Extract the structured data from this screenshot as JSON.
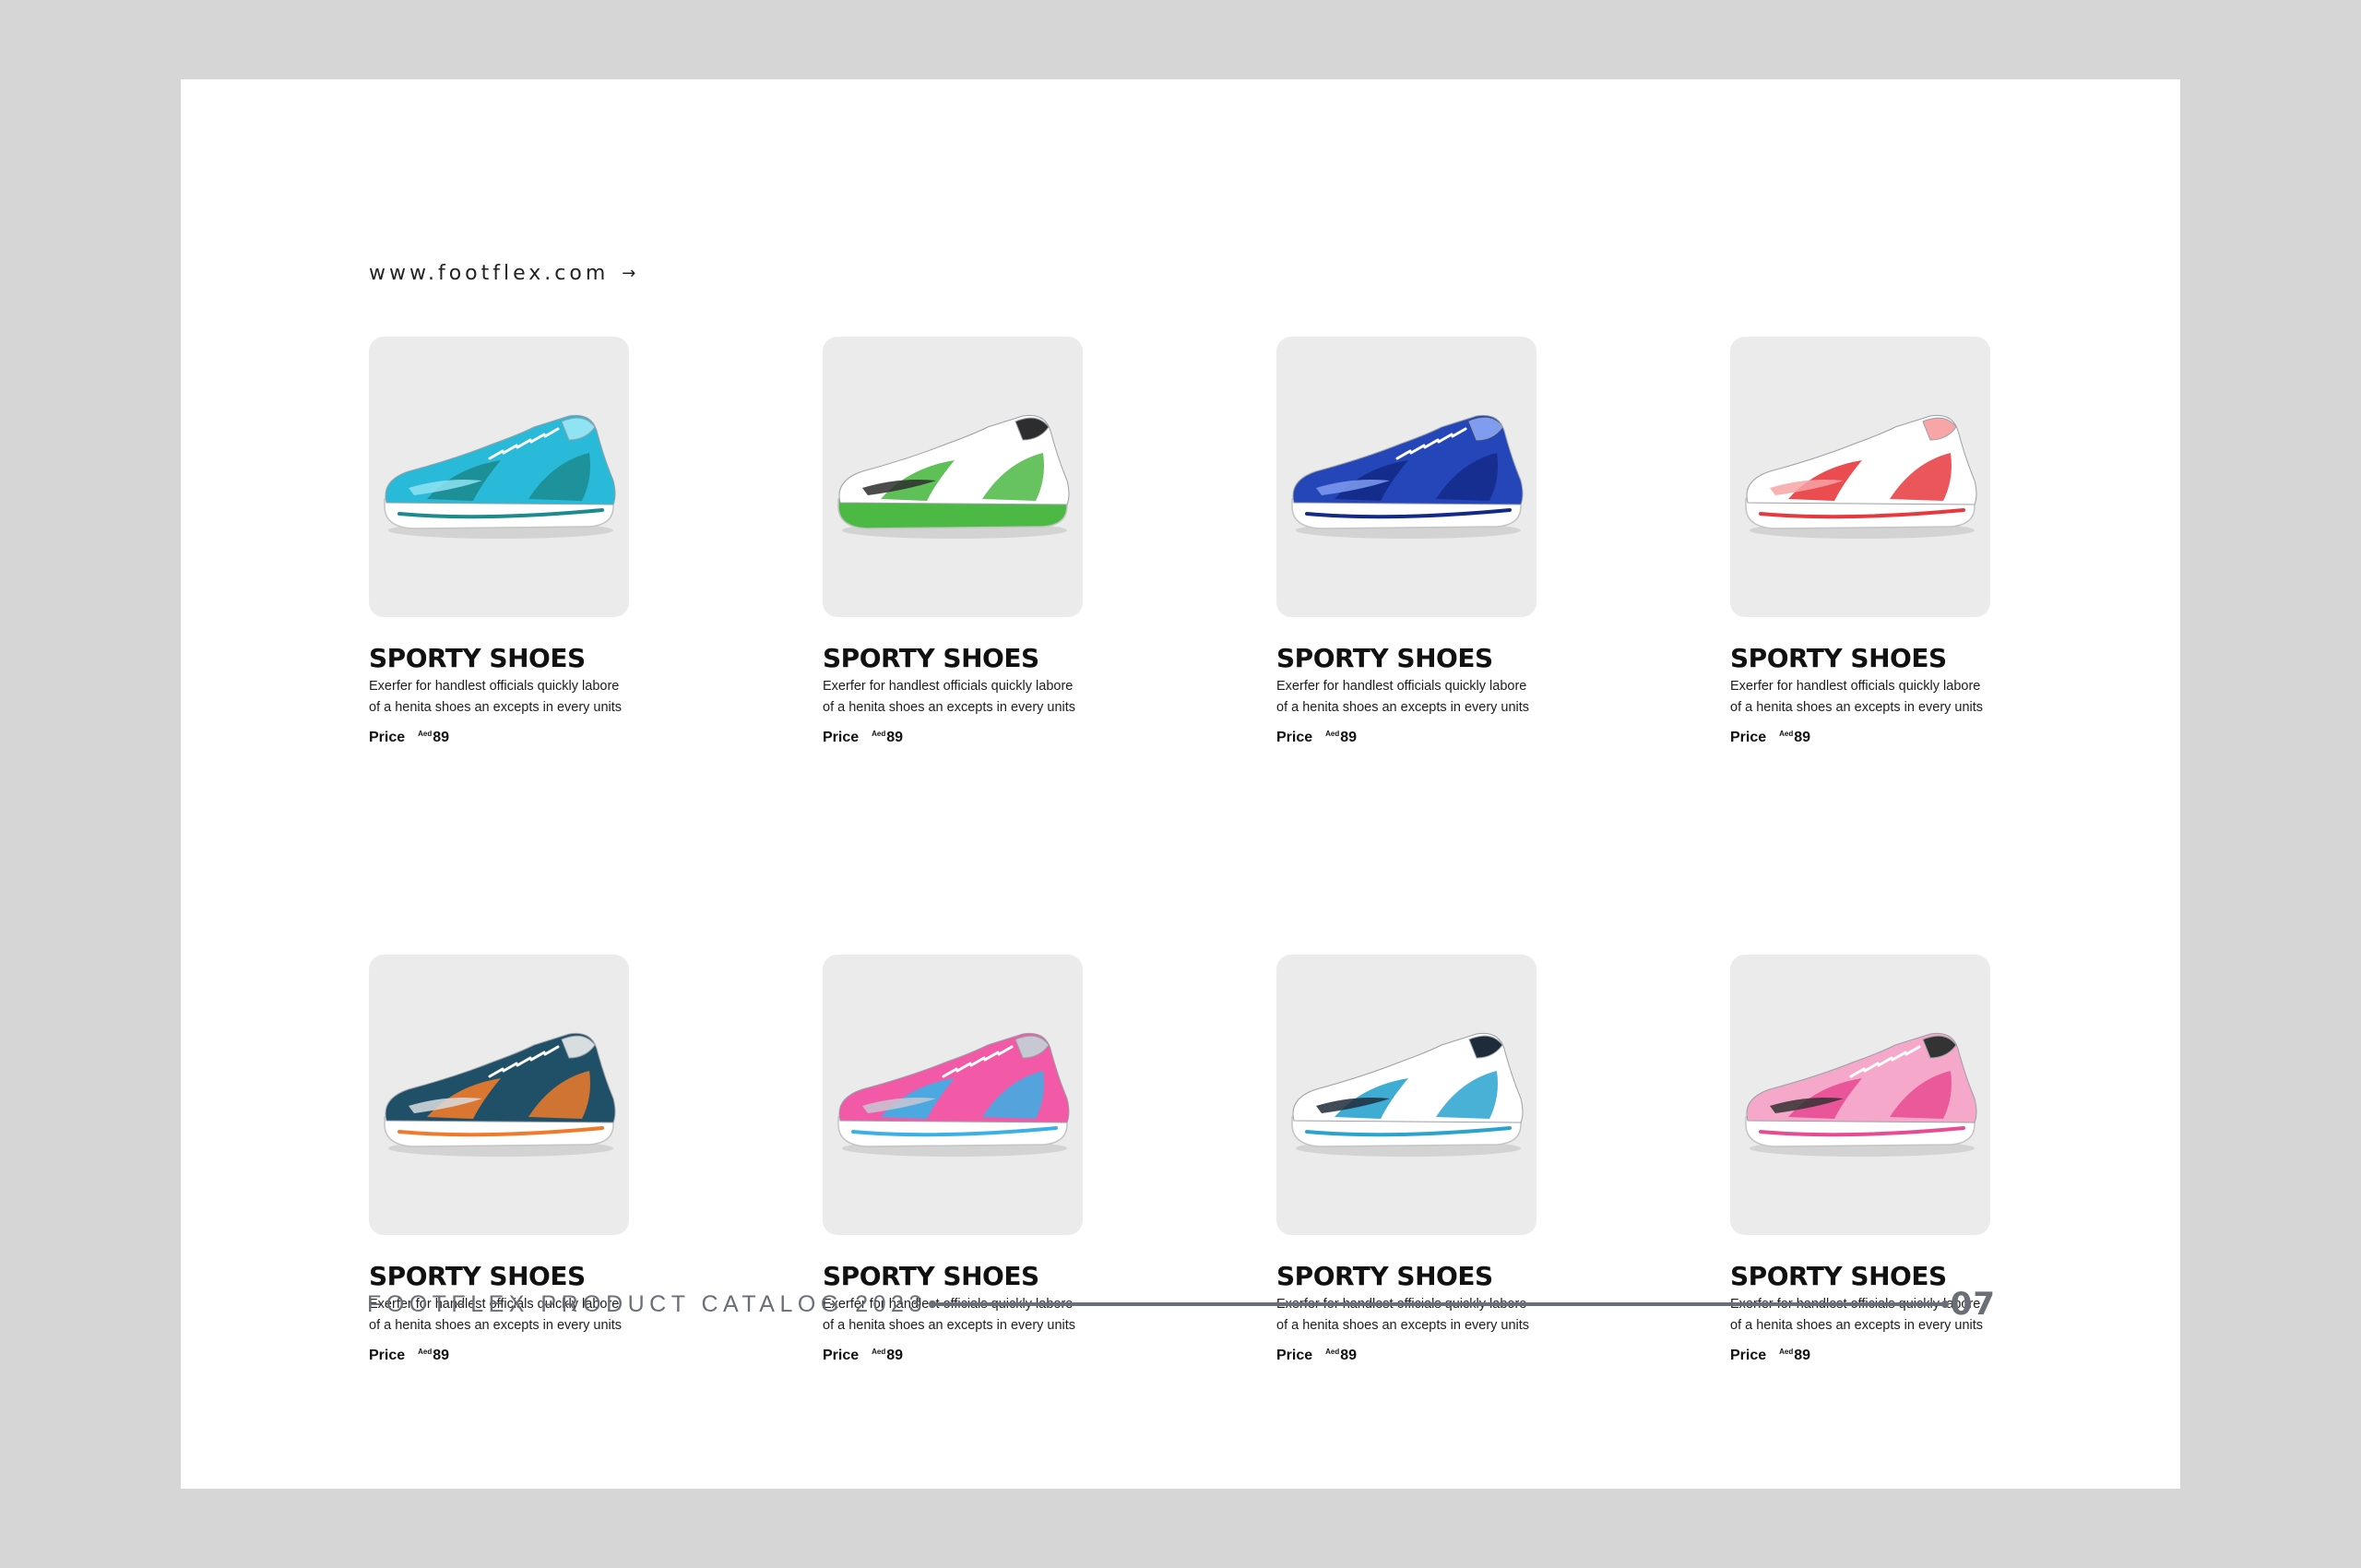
{
  "site_url": "www.footflex.com",
  "products": [
    {
      "title": "SPORTY SHOES",
      "desc_line1": "Exerfer for handlest officials quickly labore",
      "desc_line2": "of a henita shoes an excepts in every units",
      "price_label": "Price",
      "currency": "Aed",
      "price": "89",
      "colors": {
        "main": "#29b9d9",
        "accent": "#1b8b8f",
        "detail": "#8fe3f2",
        "sole": "#ffffff"
      }
    },
    {
      "title": "SPORTY SHOES",
      "desc_line1": "Exerfer for handlest officials quickly labore",
      "desc_line2": "of a henita shoes an excepts in every units",
      "price_label": "Price",
      "currency": "Aed",
      "price": "89",
      "colors": {
        "main": "#ffffff",
        "accent": "#4cb944",
        "detail": "#2d2d2d",
        "sole": "#4cb944"
      }
    },
    {
      "title": "SPORTY SHOES",
      "desc_line1": "Exerfer for handlest officials quickly labore",
      "desc_line2": "of a henita shoes an excepts in every units",
      "price_label": "Price",
      "currency": "Aed",
      "price": "89",
      "colors": {
        "main": "#2446b8",
        "accent": "#132a88",
        "detail": "#7f9cf0",
        "sole": "#ffffff"
      }
    },
    {
      "title": "SPORTY SHOES",
      "desc_line1": "Exerfer for handlest officials quickly labore",
      "desc_line2": "of a henita shoes an excepts in every units",
      "price_label": "Price",
      "currency": "Aed",
      "price": "89",
      "colors": {
        "main": "#ffffff",
        "accent": "#e8383d",
        "detail": "#f7a5a7",
        "sole": "#ffffff"
      }
    },
    {
      "title": "SPORTY SHOES",
      "desc_line1": "Exerfer for handlest officials quickly labore",
      "desc_line2": "of a henita shoes an excepts in every units",
      "price_label": "Price",
      "currency": "Aed",
      "price": "89",
      "colors": {
        "main": "#1f5068",
        "accent": "#f07a2a",
        "detail": "#d8dde0",
        "sole": "#ffffff"
      }
    },
    {
      "title": "SPORTY SHOES",
      "desc_line1": "Exerfer for handlest officials quickly labore",
      "desc_line2": "of a henita shoes an excepts in every units",
      "price_label": "Price",
      "currency": "Aed",
      "price": "89",
      "colors": {
        "main": "#f25aa8",
        "accent": "#3ab0e6",
        "detail": "#c8c8d2",
        "sole": "#ffffff"
      }
    },
    {
      "title": "SPORTY SHOES",
      "desc_line1": "Exerfer for handlest officials quickly labore",
      "desc_line2": "of a henita shoes an excepts in every units",
      "price_label": "Price",
      "currency": "Aed",
      "price": "89",
      "colors": {
        "main": "#ffffff",
        "accent": "#2aa3cf",
        "detail": "#1e2b3a",
        "sole": "#ffffff"
      }
    },
    {
      "title": "SPORTY SHOES",
      "desc_line1": "Exerfer for handlest officials quickly labore",
      "desc_line2": "of a henita shoes an excepts in every units",
      "price_label": "Price",
      "currency": "Aed",
      "price": "89",
      "colors": {
        "main": "#f6a8cb",
        "accent": "#e84b92",
        "detail": "#333333",
        "sole": "#ffffff"
      }
    }
  ],
  "footer": {
    "title": "FOOTFLEX PRODUCT CATALOG 2023",
    "page_number": "07"
  }
}
